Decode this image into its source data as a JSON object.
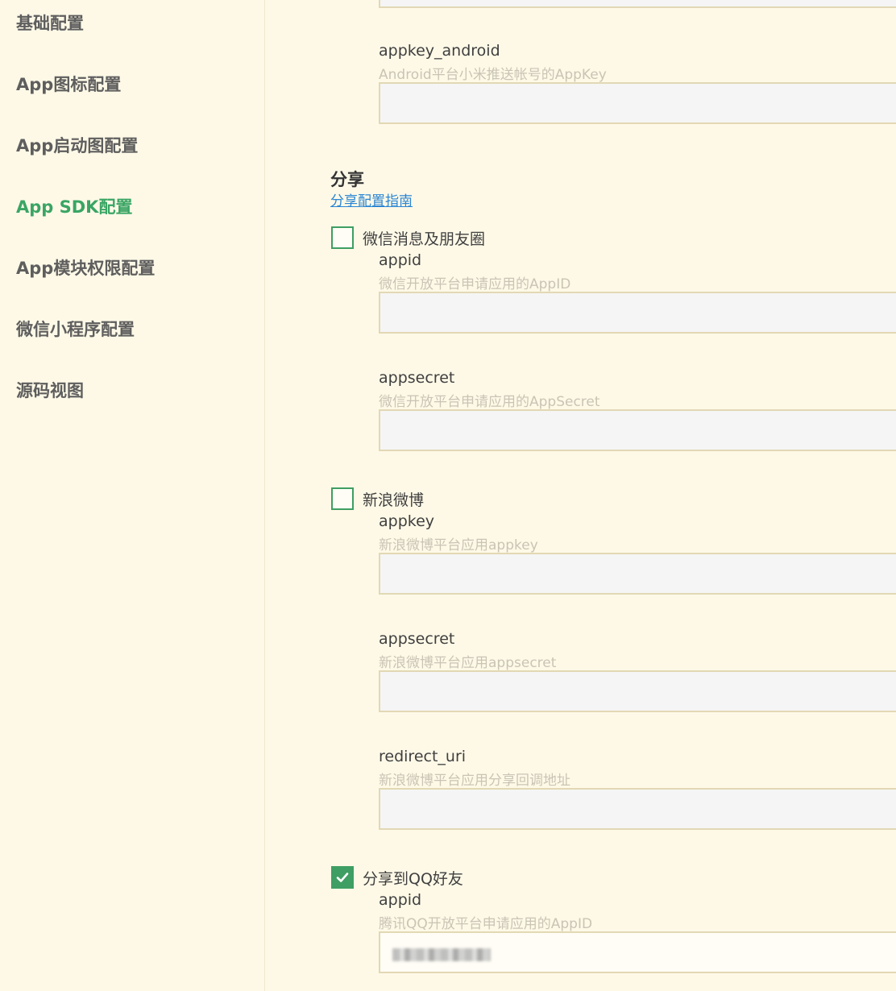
{
  "sidebar": {
    "items": [
      {
        "label": "基础配置"
      },
      {
        "label": "App图标配置"
      },
      {
        "label": "App启动图配置"
      },
      {
        "label": "App SDK配置"
      },
      {
        "label": "App模块权限配置"
      },
      {
        "label": "微信小程序配置"
      },
      {
        "label": "源码视图"
      }
    ],
    "active": "App SDK配置"
  },
  "push": {
    "appkey_android": {
      "label": "appkey_android",
      "desc": "Android平台小米推送帐号的AppKey",
      "value": ""
    }
  },
  "share": {
    "title": "分享",
    "guide_link": "分享配置指南",
    "weixin": {
      "label": "微信消息及朋友圈",
      "checked": false,
      "appid": {
        "label": "appid",
        "desc": "微信开放平台申请应用的AppID",
        "value": ""
      },
      "appsecret": {
        "label": "appsecret",
        "desc": "微信开放平台申请应用的AppSecret",
        "value": ""
      }
    },
    "sina": {
      "label": "新浪微博",
      "checked": false,
      "appkey": {
        "label": "appkey",
        "desc": "新浪微博平台应用appkey",
        "value": ""
      },
      "appsecret": {
        "label": "appsecret",
        "desc": "新浪微博平台应用appsecret",
        "value": ""
      },
      "redirect_uri": {
        "label": "redirect_uri",
        "desc": "新浪微博平台应用分享回调地址",
        "value": ""
      }
    },
    "qq": {
      "label": "分享到QQ好友",
      "checked": true,
      "appid": {
        "label": "appid",
        "desc": "腾讯QQ开放平台申请应用的AppID",
        "value": ""
      }
    }
  },
  "colors": {
    "accent": "#3aa564",
    "link": "#2b86d3",
    "background": "#fef9e7"
  }
}
